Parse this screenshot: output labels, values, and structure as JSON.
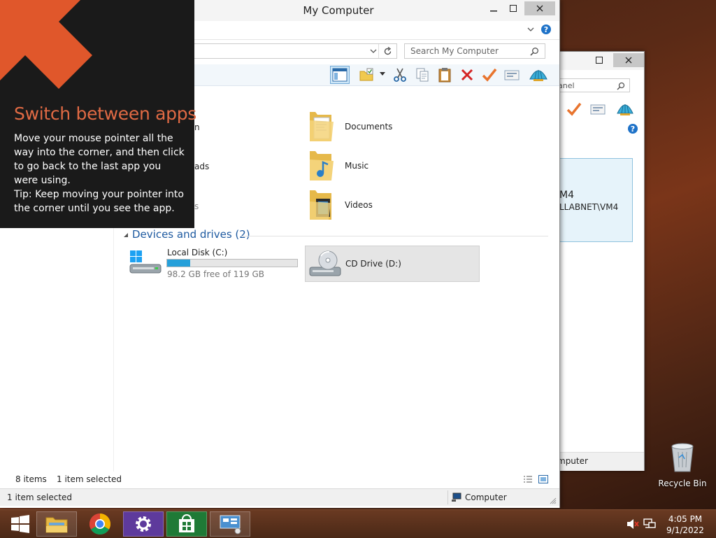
{
  "back_window": {
    "search_text": "anel",
    "panel_line1": "M4",
    "panel_line2": "LLABNET\\VM4",
    "status_text": "mputer"
  },
  "main_window": {
    "title": "My Computer",
    "search_placeholder": "Search My Computer",
    "folders": [
      {
        "label": "Documents",
        "icon": "documents-folder-icon"
      },
      {
        "label": "Music",
        "icon": "music-folder-icon"
      },
      {
        "label": "Videos",
        "icon": "videos-folder-icon"
      }
    ],
    "left_fragments": [
      "n",
      "ads",
      "s"
    ],
    "group_title": "Devices and drives (2)",
    "drives": [
      {
        "label": "Local Disk (C:)",
        "free_text": "98.2 GB free of 119 GB",
        "used_fraction": 0.175
      },
      {
        "label": "CD Drive (D:)"
      }
    ],
    "status_items": "8 items",
    "status_selected": "1 item selected",
    "statusbar_left": "1 item selected",
    "statusbar_right": "Computer"
  },
  "tip": {
    "title": "Switch between apps",
    "line1": "Move your mouse pointer all the way into the corner, and then click to go back to the last app you were using.",
    "line2": "Tip: Keep moving your pointer into the corner until you see the app."
  },
  "desktop": {
    "recycle_bin_label": "Recycle Bin"
  },
  "taskbar": {
    "apps": [
      "start-button",
      "file-explorer",
      "chrome",
      "settings",
      "store",
      "remote-desktop"
    ],
    "time": "4:05 PM",
    "date": "9/1/2022"
  },
  "colors": {
    "accent": "#e06a44",
    "selection": "#26a0da",
    "group_header": "#1e5aa0"
  }
}
